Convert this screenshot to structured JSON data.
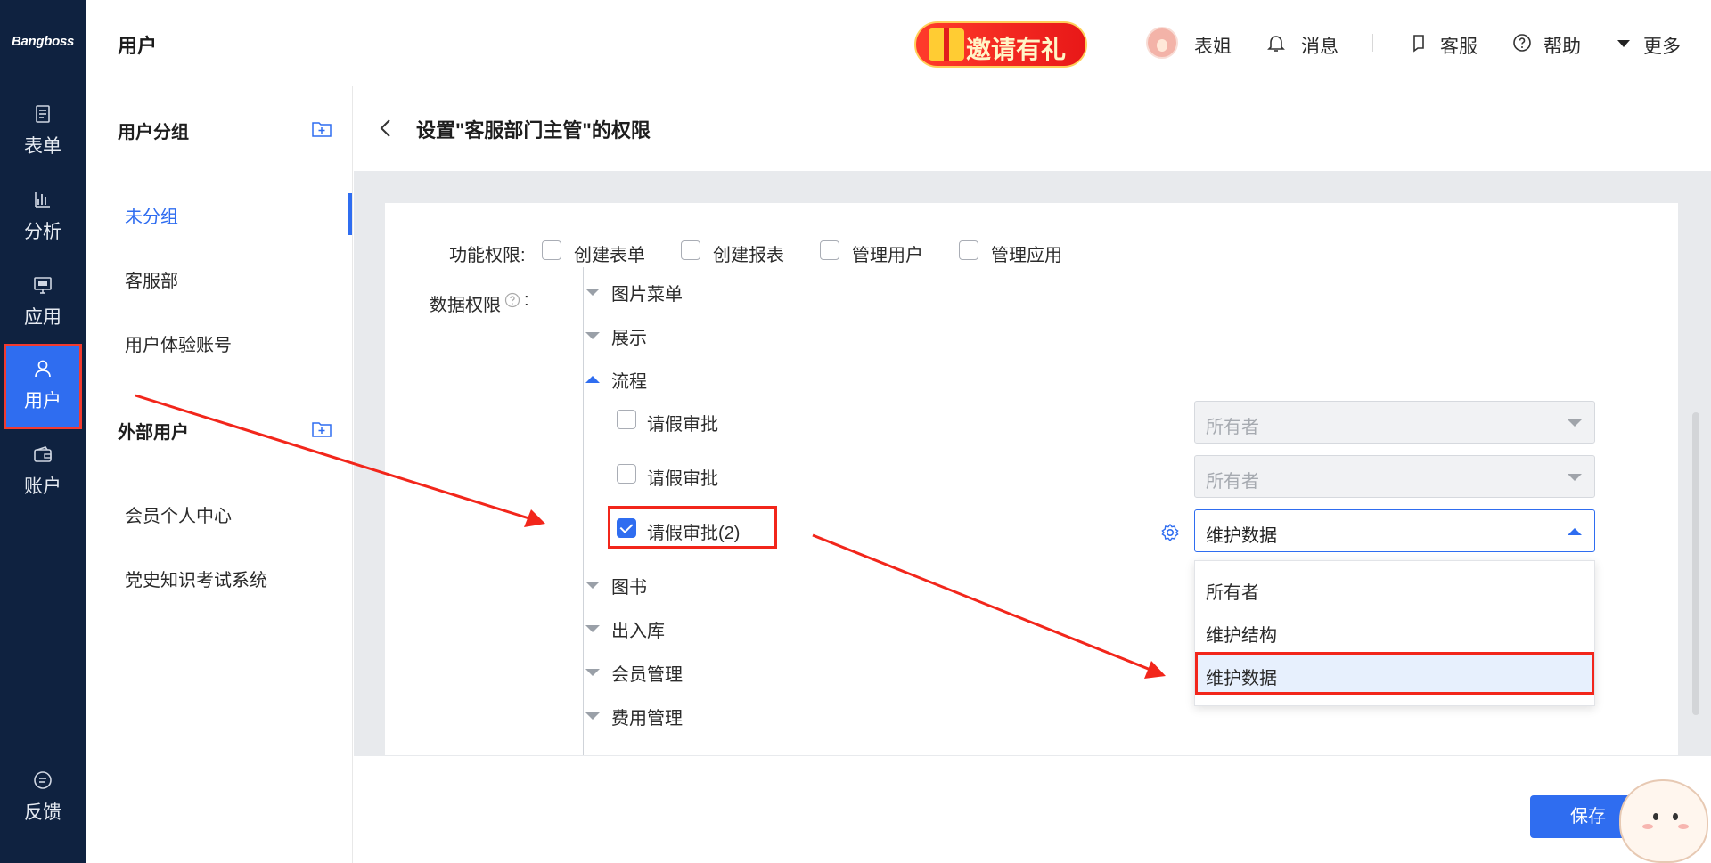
{
  "app": {
    "logo": "Bangboss"
  },
  "leftnav": {
    "items": [
      {
        "label": "表单",
        "icon": "form-icon"
      },
      {
        "label": "分析",
        "icon": "chart-icon"
      },
      {
        "label": "应用",
        "icon": "app-icon"
      },
      {
        "label": "用户",
        "icon": "user-icon",
        "active": true
      },
      {
        "label": "账户",
        "icon": "wallet-icon"
      }
    ],
    "feedback": {
      "label": "反馈",
      "icon": "feedback-icon"
    }
  },
  "header": {
    "title": "用户",
    "invite_label": "邀请有礼",
    "user_name": "表姐",
    "messages_label": "消息",
    "service_label": "客服",
    "help_label": "帮助",
    "more_label": "更多"
  },
  "groups": {
    "heading": "用户分组",
    "items": [
      "未分组",
      "客服部",
      "用户体验账号"
    ],
    "active_index": 0,
    "external_heading": "外部用户",
    "external_items": [
      "会员个人中心",
      "党史知识考试系统"
    ]
  },
  "main": {
    "title": "设置\"客服部门主管\"的权限",
    "func_label": "功能权限:",
    "func_perms": [
      {
        "label": "创建表单",
        "checked": false
      },
      {
        "label": "创建报表",
        "checked": false
      },
      {
        "label": "管理用户",
        "checked": false
      },
      {
        "label": "管理应用",
        "checked": false
      }
    ],
    "data_label": "数据权限",
    "data_colon": ":",
    "tree": {
      "nodes_top": [
        "图片菜单",
        "展示"
      ],
      "expanded": "流程",
      "children": [
        {
          "label": "请假审批",
          "checked": false,
          "select": "所有者",
          "disabled": true
        },
        {
          "label": "请假审批",
          "checked": false,
          "select": "所有者",
          "disabled": true
        },
        {
          "label": "请假审批(2)",
          "checked": true,
          "select": "维护数据",
          "disabled": false
        }
      ],
      "nodes_bottom": [
        "图书",
        "出入库",
        "会员管理",
        "费用管理"
      ]
    },
    "dropdown_options": [
      "所有者",
      "维护结构",
      "维护数据"
    ],
    "dropdown_selected": "维护数据",
    "save_label": "保存"
  },
  "colors": {
    "accent": "#2f6df0",
    "nav_bg": "#0f2240",
    "highlight": "#f2261b"
  }
}
